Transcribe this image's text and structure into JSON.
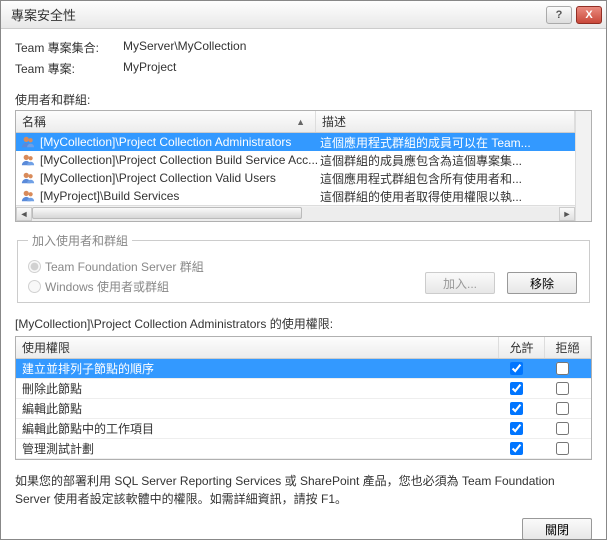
{
  "window": {
    "title": "專案安全性",
    "help": "?",
    "close": "X"
  },
  "info": {
    "collection_label": "Team 專案集合:",
    "collection_value": "MyServer\\MyCollection",
    "project_label": "Team 專案:",
    "project_value": "MyProject"
  },
  "users_section_label": "使用者和群組:",
  "list": {
    "columns": {
      "name": "名稱",
      "desc": "描述"
    },
    "rows": [
      {
        "name": "[MyCollection]\\Project Collection Administrators",
        "desc": "這個應用程式群組的成員可以在 Team...",
        "selected": true
      },
      {
        "name": "[MyCollection]\\Project Collection Build Service Acc...",
        "desc": "這個群組的成員應包含為這個專案集...",
        "selected": false
      },
      {
        "name": "[MyCollection]\\Project Collection Valid Users",
        "desc": "這個應用程式群組包含所有使用者和...",
        "selected": false
      },
      {
        "name": "[MyProject]\\Build Services",
        "desc": "這個群組的使用者取得使用權限以執...",
        "selected": false
      }
    ]
  },
  "add_group": {
    "legend": "加入使用者和群組",
    "radio_tfs": "Team Foundation Server 群組",
    "radio_windows": "Windows 使用者或群組",
    "add_btn": "加入...",
    "remove_btn": "移除"
  },
  "perm_header": "[MyCollection]\\Project Collection Administrators 的使用權限:",
  "perm_columns": {
    "name": "使用權限",
    "allow": "允許",
    "deny": "拒絕"
  },
  "permissions": [
    {
      "name": "建立並排列子節點的順序",
      "allow": true,
      "deny": false,
      "selected": true
    },
    {
      "name": "刪除此節點",
      "allow": true,
      "deny": false,
      "selected": false
    },
    {
      "name": "編輯此節點",
      "allow": true,
      "deny": false,
      "selected": false
    },
    {
      "name": "編輯此節點中的工作項目",
      "allow": true,
      "deny": false,
      "selected": false
    },
    {
      "name": "管理測試計劃",
      "allow": true,
      "deny": false,
      "selected": false
    }
  ],
  "note": "如果您的部署利用 SQL Server Reporting Services 或 SharePoint 產品，您也必須為 Team Foundation Server 使用者設定該軟體中的權限。如需詳細資訊，請按 F1。",
  "footer": {
    "close_btn": "關閉"
  }
}
